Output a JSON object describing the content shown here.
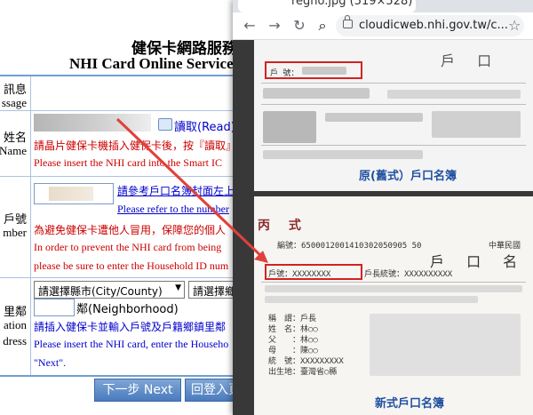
{
  "form": {
    "title_zh": "健保卡網路服務",
    "title_en": "NHI Card Online Service",
    "rows": {
      "message": {
        "label_zh": "訊息",
        "label_en": "ssage"
      },
      "name": {
        "label_zh": "姓名",
        "label_en": "Name",
        "read_button": "讀取(Read)",
        "hint_zh": "請晶片健保卡機插入健保卡後，按『讀取』鍵",
        "hint_en": "Please insert the NHI card into the Smart IC"
      },
      "household": {
        "label_zh": "戶號",
        "label_en": "mber",
        "link_zh": "請參考戶口名簿封面左上",
        "link_en": "Please refer to the number",
        "warn_zh": "為避免健保卡遭他人冒用，保障您的個人",
        "warn_en1": "In order to prevent the NHI card from being",
        "warn_en2": "please be sure to enter the Household ID num"
      },
      "address": {
        "label_zh": "里鄰",
        "label_en1": "ation",
        "label_en2": "dress",
        "county_select": "請選擇縣市(City/County)",
        "township_select": "請選擇鄉",
        "neighborhood": "鄰(Neighborhood)",
        "hint_zh": "請插入健保卡並輸入戶號及戶籍鄉鎮里鄰",
        "hint_en1": "Please insert the NHI card, enter the Househo",
        "hint_en2": "\"Next\"."
      }
    },
    "buttons": {
      "next": "下一步 Next",
      "back": "回登入頁"
    }
  },
  "browser": {
    "tab_title": "regno.jpg (519×528)",
    "url": "cloudicweb.nhi.gov.tw/c...",
    "viewer": {
      "old_card": {
        "header": "戶 口",
        "field_label": "戶 號：",
        "caption": "原(舊式）戶口名簿"
      },
      "new_card": {
        "type_label": "丙 式",
        "header": "戶 口 名",
        "code_line": "編號：6500012001410302050905 50",
        "country": "中華民國",
        "household_id_label": "戶號：XXXXXXXX",
        "head_label": "戶長統號：XXXXXXXXXX",
        "rows": [
          "稱　謂：戶長",
          "姓　名：林○○",
          "父　　：林○○",
          "母　　：陳○○",
          "統　號：XXXXXXXXX",
          "出生地：臺灣省○縣"
        ],
        "caption": "新式戶口名簿"
      }
    }
  },
  "colors": {
    "label_red": "#cc0000",
    "link_blue": "#0000cc",
    "caption_blue": "#2050a0",
    "highlight_red": "#d32222"
  }
}
